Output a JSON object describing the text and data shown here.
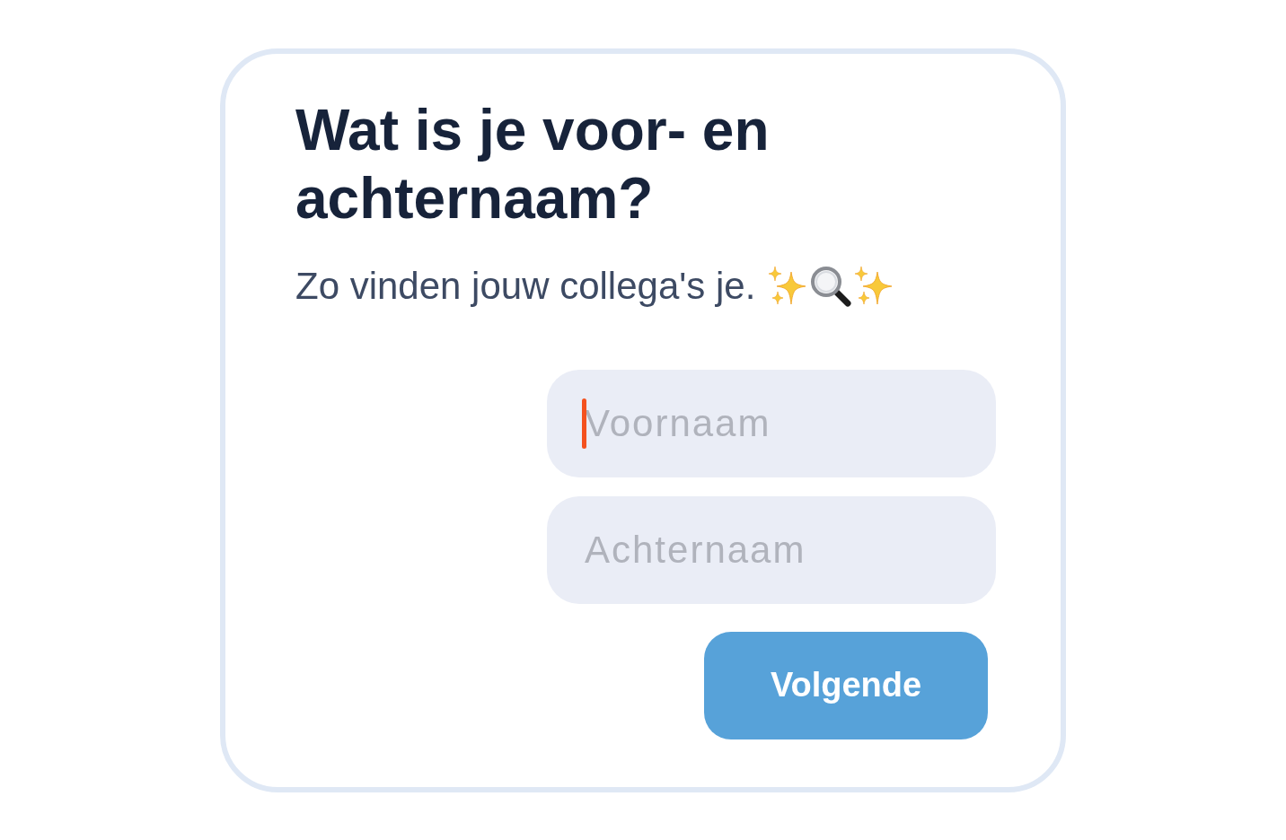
{
  "heading": "Wat is je voor- en achternaam?",
  "subtitle": "Zo vinden jouw collega's je.",
  "fields": [
    {
      "placeholder": "Voornaam",
      "focused": true
    },
    {
      "placeholder": "Achternaam",
      "focused": false
    }
  ],
  "button": {
    "label": "Volgende"
  }
}
